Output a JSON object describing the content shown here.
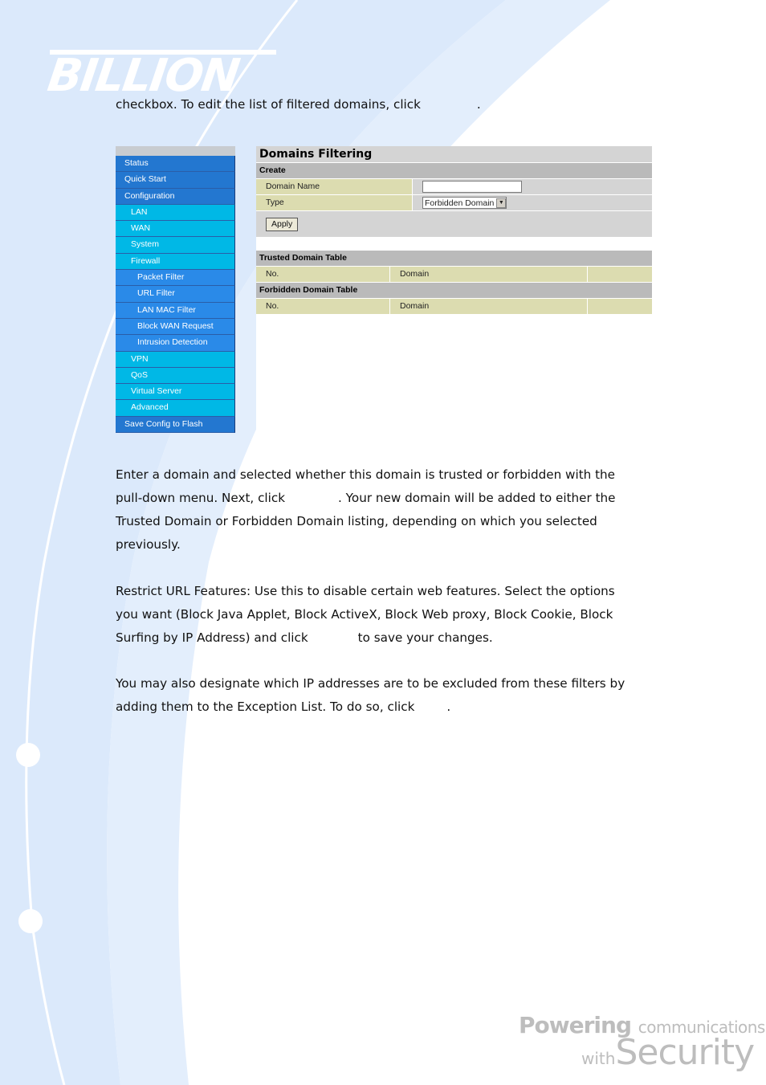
{
  "brand": {
    "logo_text": "BILLION",
    "tagline_bold": "Powering",
    "tagline_rest": "communications",
    "tagline_with": "with",
    "tagline_security": "Security"
  },
  "colors": {
    "page_bg_light_blue": "#dbe9fb",
    "sidebar_level1": "#2377d0",
    "sidebar_level2": "#00b8e6",
    "sidebar_level3": "#2a8ae8",
    "table_header_gray": "#bababa",
    "table_row_khaki": "#dcdcb0",
    "panel_gray": "#d4d4d4"
  },
  "intro": {
    "before": "checkbox. To edit the list of filtered domains, click",
    "after": "."
  },
  "sidebar": {
    "items": [
      {
        "label": "Status",
        "level": 1
      },
      {
        "label": "Quick Start",
        "level": 1
      },
      {
        "label": "Configuration",
        "level": 1
      },
      {
        "label": "LAN",
        "level": 2
      },
      {
        "label": "WAN",
        "level": 2
      },
      {
        "label": "System",
        "level": 2
      },
      {
        "label": "Firewall",
        "level": 2
      },
      {
        "label": "Packet Filter",
        "level": 3
      },
      {
        "label": "URL Filter",
        "level": 3
      },
      {
        "label": "LAN MAC Filter",
        "level": 3
      },
      {
        "label": "Block WAN Request",
        "level": 3
      },
      {
        "label": "Intrusion Detection",
        "level": 3
      },
      {
        "label": "VPN",
        "level": 2
      },
      {
        "label": "QoS",
        "level": 2
      },
      {
        "label": "Virtual Server",
        "level": 2
      },
      {
        "label": "Advanced",
        "level": 2
      },
      {
        "label": "Save Config to Flash",
        "level": 1
      }
    ]
  },
  "panel": {
    "title": "Domains Filtering",
    "create_header": "Create",
    "domain_name_label": "Domain Name",
    "domain_name_value": "",
    "type_label": "Type",
    "type_selected": "Forbidden Domain",
    "apply_label": "Apply",
    "trusted_header": "Trusted Domain Table",
    "forbidden_header": "Forbidden Domain Table",
    "col_no": "No.",
    "col_domain": "Domain"
  },
  "paragraphs": {
    "p1_line1": "Enter a domain and selected whether this domain is trusted or forbidden with the",
    "p1_line2_before": "pull-down menu. Next, click",
    "p1_line2_after": ". Your new domain will be added to either the",
    "p1_line3": "Trusted Domain or Forbidden Domain listing, depending on which you selected",
    "p1_line4": "previously.",
    "p2_line1": "Restrict URL Features: Use this to disable certain web features. Select the options",
    "p2_line2": "you want (Block Java Applet, Block ActiveX, Block Web proxy, Block Cookie, Block",
    "p2_line3_before": "Surfing by IP Address) and click",
    "p2_line3_after": "to save your changes.",
    "p3_line1": "You may also designate which IP addresses are to be excluded from these filters by",
    "p3_line2_before": "adding them to the Exception List. To do so, click",
    "p3_line2_after": "."
  }
}
